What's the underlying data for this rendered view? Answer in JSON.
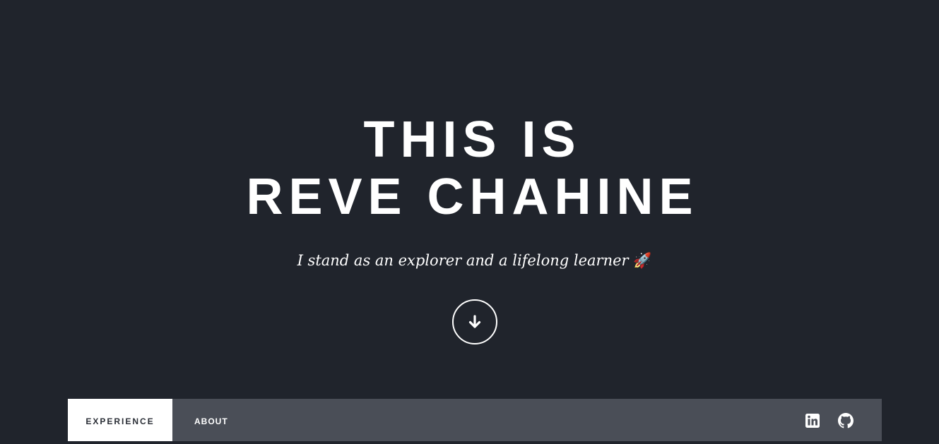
{
  "hero": {
    "title_line1": "THIS IS",
    "title_line2": "REVE CHAHINE",
    "tagline": "I stand as an explorer and a lifelong learner",
    "tagline_emoji": "🚀",
    "scroll_icon": "arrow-down-icon"
  },
  "nav": {
    "items": [
      {
        "label": "EXPERIENCE",
        "active": true
      },
      {
        "label": "ABOUT",
        "active": false
      }
    ],
    "social": [
      {
        "icon": "linkedin-icon"
      },
      {
        "icon": "github-icon"
      }
    ]
  },
  "colors": {
    "background": "#20242c",
    "nav_background": "#4a4e57",
    "text": "#ffffff",
    "active_nav_text": "#2b2f37"
  }
}
